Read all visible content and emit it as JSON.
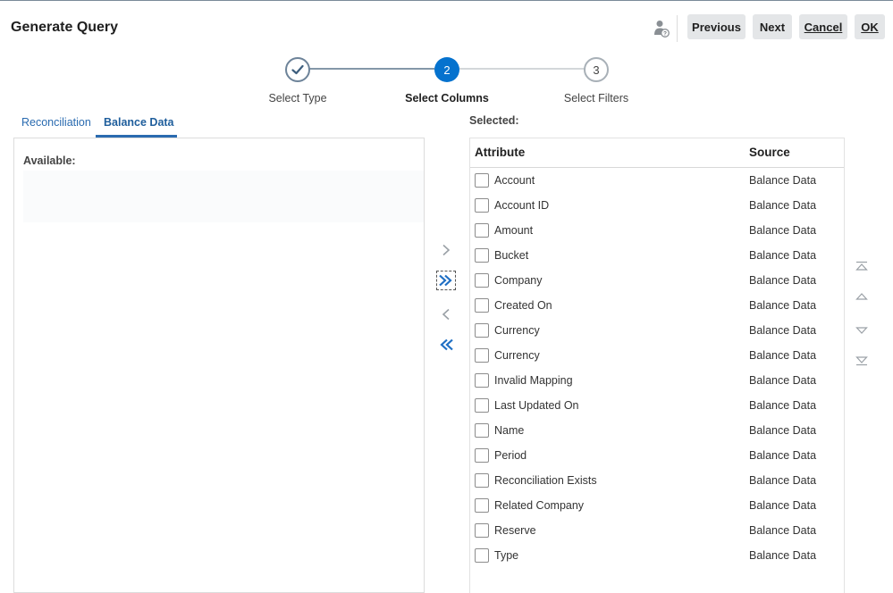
{
  "header": {
    "title": "Generate Query",
    "help_icon": "user-help-icon",
    "buttons": {
      "previous": "Previous",
      "next": "Next",
      "cancel": "Cancel",
      "ok": "OK"
    }
  },
  "train": {
    "steps": [
      {
        "number": "",
        "label": "Select Type",
        "state": "completed",
        "icon": "check-icon"
      },
      {
        "number": "2",
        "label": "Select Columns",
        "state": "current"
      },
      {
        "number": "3",
        "label": "Select Filters",
        "state": "upcoming"
      }
    ]
  },
  "tabs": [
    {
      "label": "Reconciliation",
      "selected": false
    },
    {
      "label": "Balance Data",
      "selected": true
    }
  ],
  "available": {
    "label": "Available:",
    "items": []
  },
  "shuttle": {
    "move_selected_icon": "chevron-right-icon",
    "move_all_icon": "double-chevron-right-icon",
    "remove_selected_icon": "chevron-left-icon",
    "remove_all_icon": "double-chevron-left-icon"
  },
  "selected": {
    "label": "Selected:",
    "columns": [
      "Attribute",
      "Source"
    ],
    "rows": [
      {
        "attribute": "Account",
        "source": "Balance Data"
      },
      {
        "attribute": "Account ID",
        "source": "Balance Data"
      },
      {
        "attribute": "Amount",
        "source": "Balance Data"
      },
      {
        "attribute": "Bucket",
        "source": "Balance Data"
      },
      {
        "attribute": "Company",
        "source": "Balance Data"
      },
      {
        "attribute": "Created On",
        "source": "Balance Data"
      },
      {
        "attribute": "Currency",
        "source": "Balance Data"
      },
      {
        "attribute": "Currency",
        "source": "Balance Data"
      },
      {
        "attribute": "Invalid Mapping",
        "source": "Balance Data"
      },
      {
        "attribute": "Last Updated On",
        "source": "Balance Data"
      },
      {
        "attribute": "Name",
        "source": "Balance Data"
      },
      {
        "attribute": "Period",
        "source": "Balance Data"
      },
      {
        "attribute": "Reconciliation Exists",
        "source": "Balance Data"
      },
      {
        "attribute": "Related Company",
        "source": "Balance Data"
      },
      {
        "attribute": "Reserve",
        "source": "Balance Data"
      },
      {
        "attribute": "Type",
        "source": "Balance Data"
      }
    ]
  },
  "reorder": {
    "move_top_icon": "move-to-top-icon",
    "move_up_icon": "move-up-icon",
    "move_down_icon": "move-down-icon",
    "move_bottom_icon": "move-to-bottom-icon"
  },
  "colors": {
    "accent": "#0572ce",
    "tab_link": "#2a6bb0",
    "train_done": "#4c6c8a",
    "button_bg": "#e4e6e8"
  }
}
